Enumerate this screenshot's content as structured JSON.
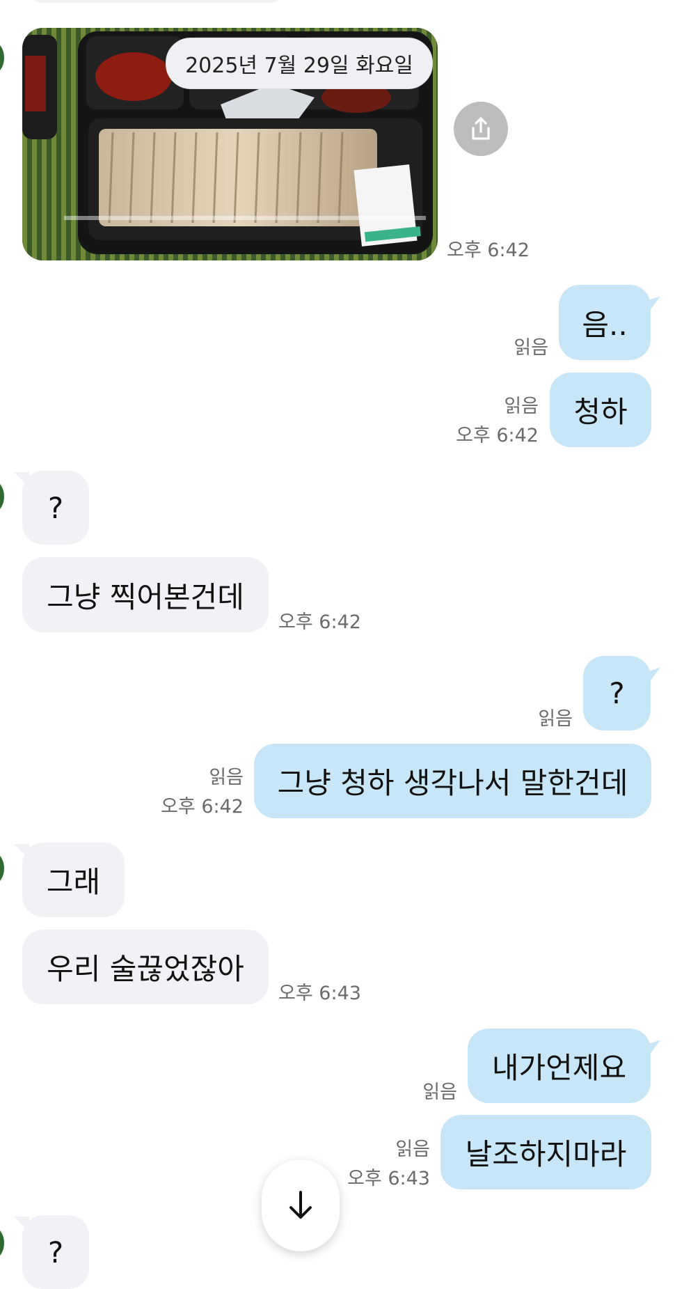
{
  "date_separator": "2025년 7월 29일 화요일",
  "photo_message": {
    "alt": "plastic takeout tray of sliced meat with side dishes",
    "time": "오후 6:42"
  },
  "share_button": {
    "icon": "share-upload-icon"
  },
  "messages": [
    {
      "dir": "out",
      "text": "음..",
      "read": "읽음"
    },
    {
      "dir": "out",
      "text": "청하",
      "read": "읽음",
      "time": "오후 6:42"
    },
    {
      "dir": "in",
      "text": "?"
    },
    {
      "dir": "in",
      "text": "그냥 찍어본건데",
      "time": "오후 6:42"
    },
    {
      "dir": "out",
      "text": "?",
      "read": "읽음"
    },
    {
      "dir": "out",
      "text": "그냥 청하 생각나서 말한건데",
      "read": "읽음",
      "time": "오후 6:42"
    },
    {
      "dir": "in",
      "text": "그래"
    },
    {
      "dir": "in",
      "text": "우리 술끊었잖아",
      "time": "오후 6:43"
    },
    {
      "dir": "out",
      "text": "내가언제요",
      "read": "읽음"
    },
    {
      "dir": "out",
      "text": "날조하지마라",
      "read": "읽음",
      "time": "오후 6:43"
    },
    {
      "dir": "in",
      "text": "?"
    }
  ],
  "scroll_down_button": {
    "icon": "arrow-down-icon"
  },
  "colors": {
    "incoming_bubble": "#f1f2f6",
    "outgoing_bubble": "#c7e7f8",
    "meta_text": "#6b6b6b"
  }
}
